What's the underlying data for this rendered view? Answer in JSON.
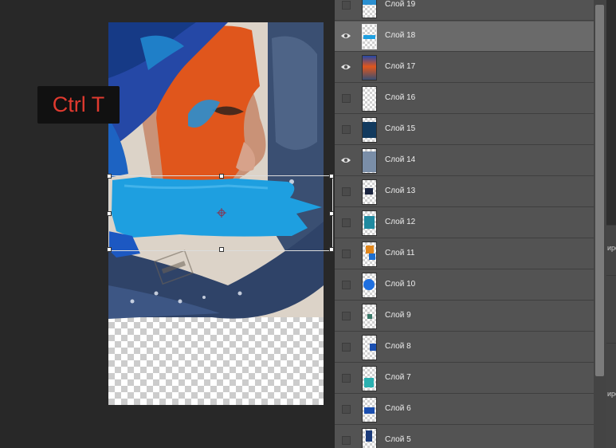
{
  "shortcut_hint": "Ctrl T",
  "layers": [
    {
      "name": "Слой 19",
      "visible": false,
      "thumb_icon": "texture-thumbnail-icon"
    },
    {
      "name": "Слой 18",
      "visible": true,
      "selected": true,
      "thumb_icon": "blue-stroke-thumbnail-icon"
    },
    {
      "name": "Слой 17",
      "visible": true,
      "thumb_icon": "portrait-thumbnail-icon"
    },
    {
      "name": "Слой 16",
      "visible": false,
      "thumb_icon": "transparent-thumbnail-icon"
    },
    {
      "name": "Слой 15",
      "visible": false,
      "thumb_icon": "dark-texture-thumbnail-icon"
    },
    {
      "name": "Слой 14",
      "visible": true,
      "thumb_icon": "fabric-thumbnail-icon"
    },
    {
      "name": "Слой 13",
      "visible": false,
      "thumb_icon": "small-object-thumbnail-icon"
    },
    {
      "name": "Слой 12",
      "visible": false,
      "thumb_icon": "teal-thumbnail-icon"
    },
    {
      "name": "Слой 11",
      "visible": false,
      "thumb_icon": "orange-blue-thumbnail-icon"
    },
    {
      "name": "Слой 10",
      "visible": false,
      "thumb_icon": "blue-circle-thumbnail-icon"
    },
    {
      "name": "Слой 9",
      "visible": false,
      "thumb_icon": "small-green-thumbnail-icon"
    },
    {
      "name": "Слой 8",
      "visible": false,
      "thumb_icon": "blue-square-thumbnail-icon"
    },
    {
      "name": "Слой 7",
      "visible": false,
      "thumb_icon": "teal-splash-thumbnail-icon"
    },
    {
      "name": "Слой 6",
      "visible": false,
      "thumb_icon": "blue-rect-thumbnail-icon"
    },
    {
      "name": "Слой 5",
      "visible": false,
      "thumb_icon": "dark-figure-thumbnail-icon"
    }
  ],
  "right_panel_fragments": [
    "ирo",
    "иро"
  ],
  "colors": {
    "panel_bg": "#535353",
    "selected_row": "#6a6a6a",
    "workspace_bg": "#282828",
    "hint_text": "#e03a2f",
    "paint_blue": "#1e9fe0",
    "paint_orange": "#e0561c"
  }
}
